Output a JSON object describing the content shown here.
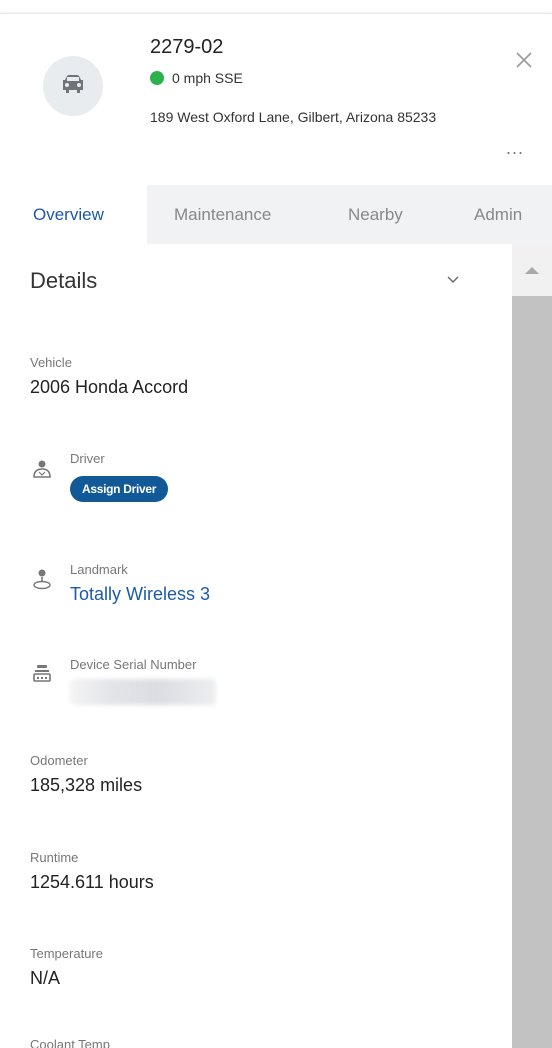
{
  "header": {
    "vehicle_id": "2279-02",
    "status": "0 mph SSE",
    "status_color": "#2bb24c",
    "address": "189 West Oxford Lane, Gilbert, Arizona 85233",
    "avatar_icon": "car-icon",
    "close_icon": "close-icon",
    "more_label": "..."
  },
  "tabs": [
    {
      "label": "Overview",
      "active": true
    },
    {
      "label": "Maintenance",
      "active": false
    },
    {
      "label": "Nearby",
      "active": false
    },
    {
      "label": "Admin",
      "active": false
    }
  ],
  "details": {
    "title": "Details",
    "vehicle": {
      "label": "Vehicle",
      "value": "2006 Honda Accord"
    },
    "driver": {
      "label": "Driver",
      "button": "Assign Driver"
    },
    "landmark": {
      "label": "Landmark",
      "value": "Totally Wireless 3"
    },
    "device": {
      "label": "Device Serial Number"
    },
    "odometer": {
      "label": "Odometer",
      "value": "185,328 miles"
    },
    "runtime": {
      "label": "Runtime",
      "value": "1254.611 hours"
    },
    "temperature": {
      "label": "Temperature",
      "value": "N/A"
    },
    "coolant": {
      "label": "Coolant Temp"
    }
  },
  "colors": {
    "accent": "#1c5aa6",
    "button": "#125a97"
  }
}
